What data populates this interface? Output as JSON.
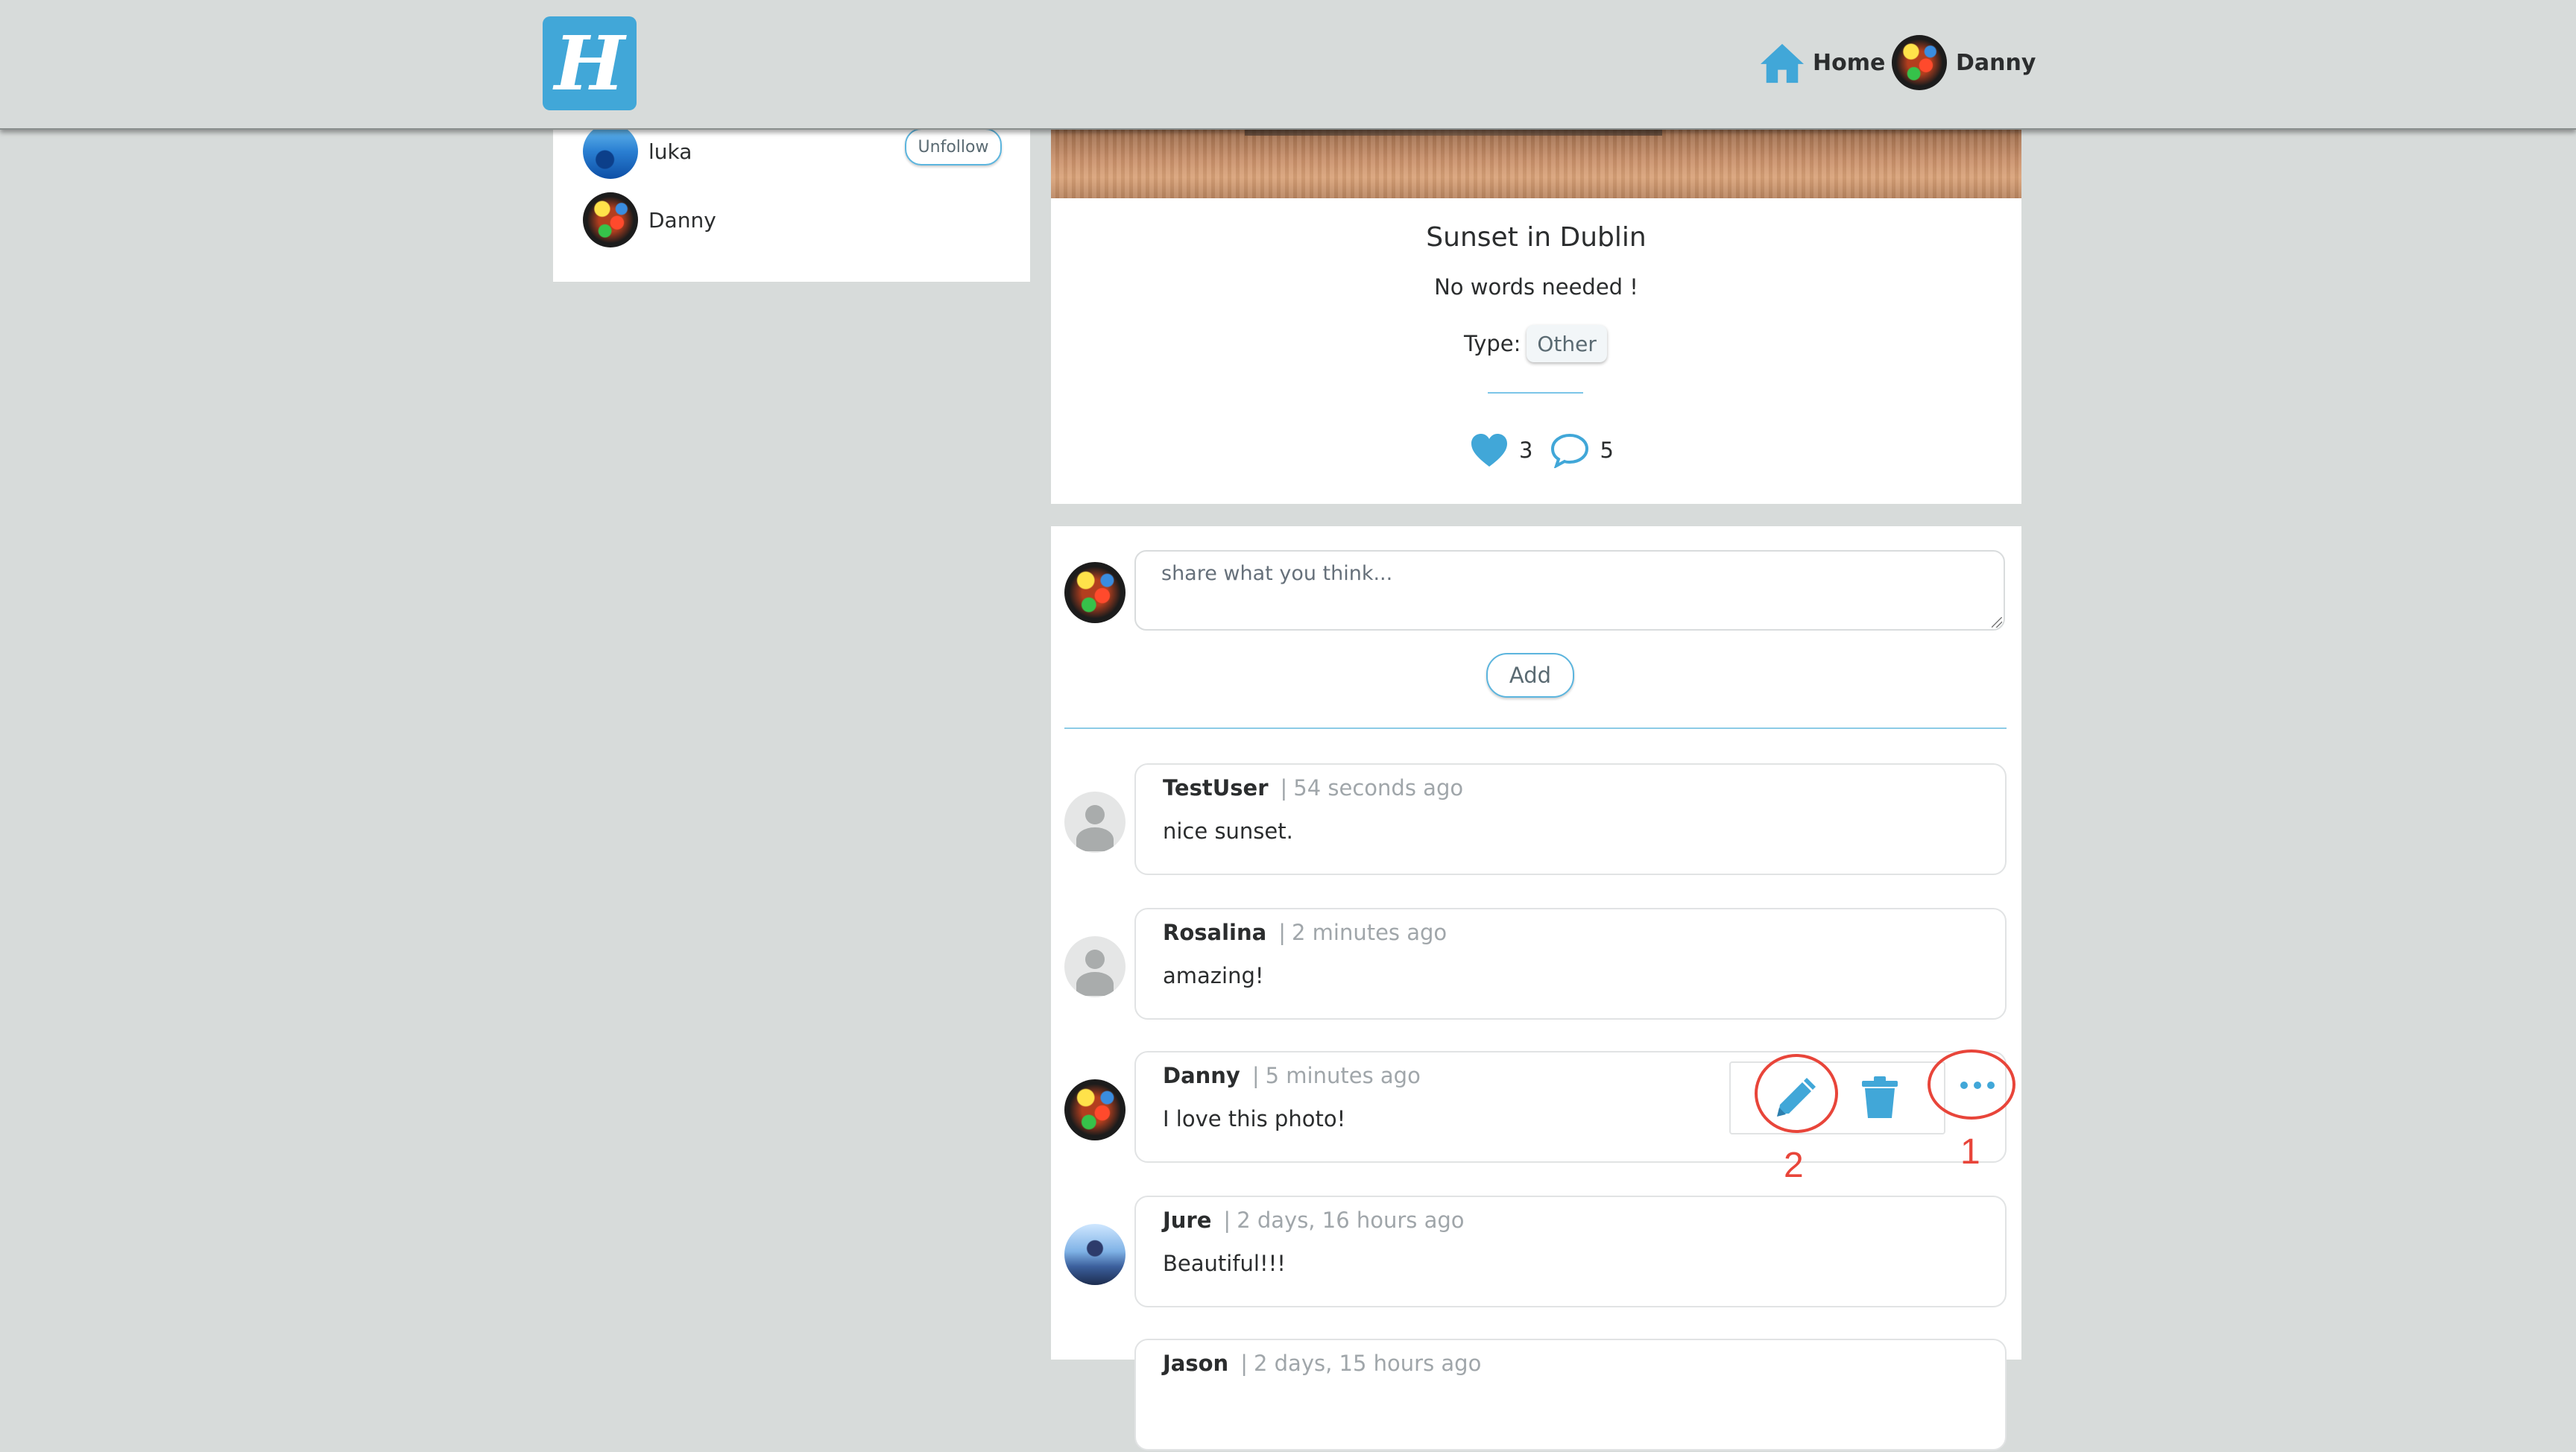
{
  "header": {
    "logo_text": "H",
    "nav_home": "Home",
    "nav_user": "Danny"
  },
  "sidebar": {
    "following": [
      {
        "name": "luka",
        "action": "Unfollow"
      },
      {
        "name": "Danny"
      }
    ]
  },
  "post": {
    "title": "Sunset in Dublin",
    "description": "No words needed !",
    "type_label": "Type:",
    "type_value": "Other",
    "likes": "3",
    "comments": "5"
  },
  "comment_form": {
    "placeholder": "share what you think...",
    "add_label": "Add"
  },
  "comments": [
    {
      "author": "TestUser",
      "sep": "|",
      "time": "54 seconds ago",
      "text": "nice sunset."
    },
    {
      "author": "Rosalina",
      "sep": "|",
      "time": "2 minutes ago",
      "text": "amazing!"
    },
    {
      "author": "Danny",
      "sep": "|",
      "time": "5 minutes ago",
      "text": "I love this photo!"
    },
    {
      "author": "Jure",
      "sep": "|",
      "time": "2 days, 16 hours ago",
      "text": "Beautiful!!!"
    },
    {
      "author": "Jason",
      "sep": "|",
      "time": "2 days, 15 hours ago",
      "text": ""
    }
  ],
  "annotations": [
    {
      "label": "1",
      "target": "more-options"
    },
    {
      "label": "2",
      "target": "edit"
    }
  ],
  "colors": {
    "accent": "#41a7d8",
    "background": "#d7dbda",
    "annotation": "#e8453a"
  },
  "icons": [
    "home-icon",
    "heart-icon",
    "comment-icon",
    "pencil-icon",
    "trash-icon",
    "ellipsis-icon"
  ]
}
